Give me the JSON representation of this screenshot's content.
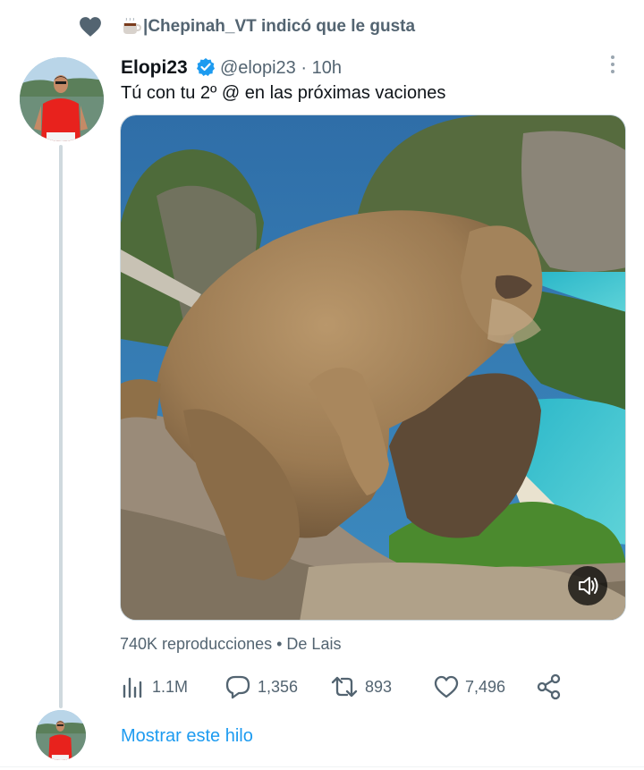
{
  "social_context": {
    "emoji_label": "coffee-cup",
    "text": "|Chepinah_VT indicó que le gusta"
  },
  "tweet": {
    "author_name": "Elopi23",
    "verified": true,
    "handle": "@elopi23",
    "separator": "·",
    "time": "10h",
    "text": "Tú con tu 2º @ en las próximas vaciones",
    "views_line": "740K reproducciones • De Lais",
    "actions": {
      "views": "1.1M",
      "replies": "1,356",
      "retweets": "893",
      "likes": "7,496"
    },
    "show_thread": "Mostrar este hilo"
  },
  "colors": {
    "accent": "#1d9bf0",
    "secondary_text": "#536471",
    "verified_badge": "#1d9bf0",
    "thread_line": "#cfd9de"
  },
  "icons": [
    "heart-icon",
    "verified-badge-icon",
    "more-options-icon",
    "volume-icon",
    "views-icon",
    "reply-icon",
    "retweet-icon",
    "like-icon",
    "share-icon"
  ]
}
